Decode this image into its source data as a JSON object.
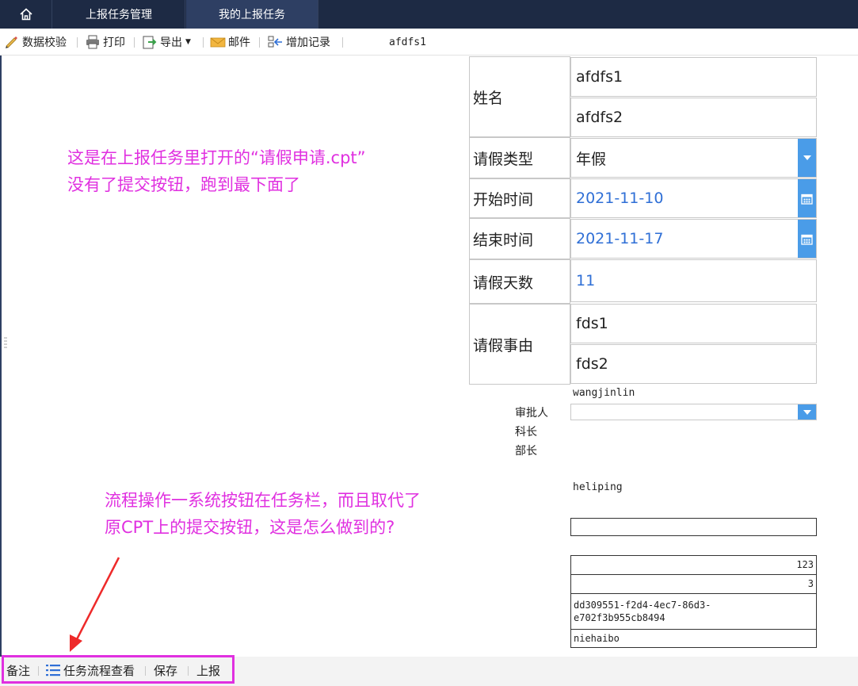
{
  "tabs": {
    "home_icon": "home-icon",
    "items": [
      "上报任务管理",
      "我的上报任务"
    ],
    "active_index": 1
  },
  "toolbar": {
    "validate": "数据校验",
    "print": "打印",
    "export": "导出",
    "mail": "邮件",
    "add_record": "增加记录",
    "doc_name": "afdfs1"
  },
  "form": {
    "name_label": "姓名",
    "name_values": [
      "afdfs1",
      "afdfs2"
    ],
    "leave_type_label": "请假类型",
    "leave_type_value": "年假",
    "start_label": "开始时间",
    "start_value": "2021-11-10",
    "end_label": "结束时间",
    "end_value": "2021-11-17",
    "days_label": "请假天数",
    "days_value": "11",
    "reason_label": "请假事由",
    "reason_values": [
      "fds1",
      "fds2"
    ]
  },
  "approval": {
    "approver_name": "wangjinlin",
    "approver_label": "审批人",
    "section_chief_label": "科长",
    "dept_head_label": "部长",
    "other_name": "heliping",
    "cells": [
      "123",
      "3",
      "dd309551-f2d4-4ec7-86d3-",
      "e702f3b955cb8494",
      "niehaibo"
    ]
  },
  "annotations": {
    "note1_line1": "这是在上报任务里打开的“请假申请.cpt”",
    "note1_line2": "没有了提交按钮，跑到最下面了",
    "note2_line1": "流程操作一系统按钮在任务栏，而且取代了",
    "note2_line2": "原CPT上的提交按钮，这是怎么做到的?"
  },
  "bottombar": {
    "remark": "备注",
    "flow_view": "任务流程查看",
    "save": "保存",
    "report": "上报"
  },
  "colors": {
    "topbar": "#1d2a44",
    "accent_blue": "#4a9ce8",
    "annotation": "#e030e0",
    "date_text": "#2f6fd6"
  }
}
